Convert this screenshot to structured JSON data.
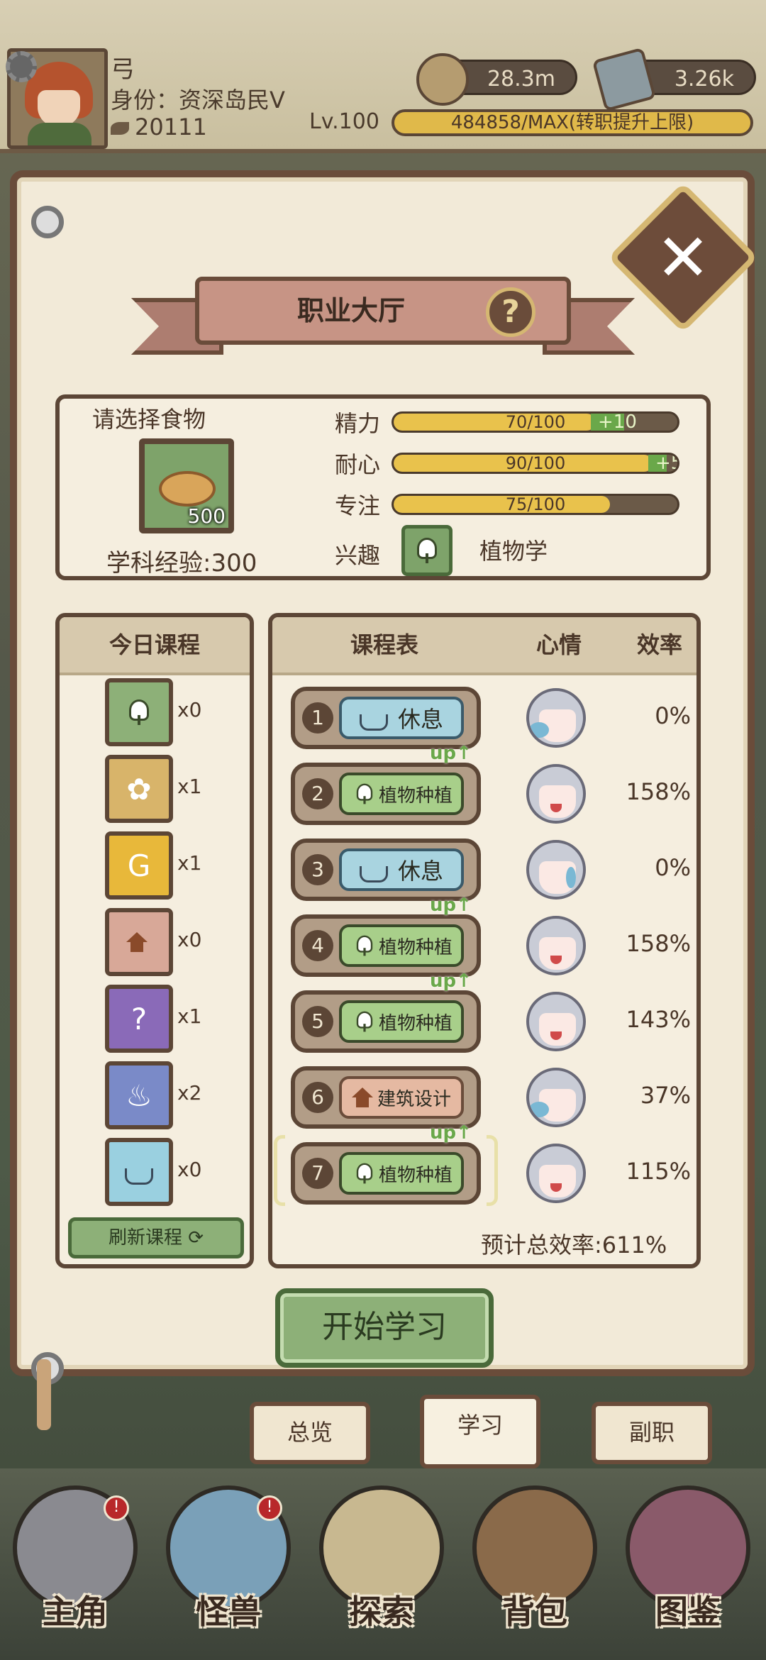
{
  "player": {
    "name": "弓",
    "identity": "身份：资深岛民Ⅴ",
    "leaf_count": "20111",
    "level": "Lv.100",
    "xp_text": "484858/MAX(转职提升上限)"
  },
  "currencies": {
    "coins": "28.3m",
    "stones": "3.26k"
  },
  "panel": {
    "title": "职业大厅",
    "help": "?",
    "close": "✕"
  },
  "food": {
    "label": "请选择食物",
    "count": "500",
    "exp": "学科经验:300"
  },
  "stats": [
    {
      "label": "精力",
      "value": "70/100",
      "bonus": "+10",
      "fill": 0.7,
      "bonus_fill": 0.1
    },
    {
      "label": "耐心",
      "value": "90/100",
      "bonus": "+5",
      "fill": 0.9,
      "bonus_fill": 0.05
    },
    {
      "label": "专注",
      "value": "75/100",
      "bonus": "",
      "fill": 0.75,
      "bonus_fill": 0
    }
  ],
  "interest": {
    "label": "兴趣",
    "value": "植物学"
  },
  "today": {
    "header": "今日课程",
    "items": [
      {
        "icon": "leaf-icon",
        "count": "x0",
        "color": "#8db078"
      },
      {
        "icon": "paw-icon",
        "count": "x1",
        "color": "#d8b46a"
      },
      {
        "icon": "money-bag-icon",
        "count": "x1",
        "color": "#e8b83a"
      },
      {
        "icon": "house-icon",
        "count": "x0",
        "color": "#d8a898"
      },
      {
        "icon": "potion-icon",
        "count": "x1",
        "color": "#8a6ab8"
      },
      {
        "icon": "water-icon",
        "count": "x2",
        "color": "#7a8ac8"
      },
      {
        "icon": "cup-icon",
        "count": "x0",
        "color": "#9ad0e0"
      }
    ],
    "refresh": "刷新课程"
  },
  "schedule": {
    "headers": {
      "course": "课程表",
      "mood": "心情",
      "efficiency": "效率"
    },
    "rows": [
      {
        "num": "1",
        "course": "休息",
        "type": "rest",
        "up": "",
        "mood": "sleepy",
        "eff": "0%"
      },
      {
        "num": "2",
        "course": "植物种植",
        "type": "plant",
        "up": "up↑",
        "mood": "happy",
        "eff": "158%"
      },
      {
        "num": "3",
        "course": "休息",
        "type": "rest",
        "up": "",
        "mood": "crying",
        "eff": "0%"
      },
      {
        "num": "4",
        "course": "植物种植",
        "type": "plant",
        "up": "up↑",
        "mood": "happy",
        "eff": "158%"
      },
      {
        "num": "5",
        "course": "植物种植",
        "type": "plant",
        "up": "up↑",
        "mood": "happy",
        "eff": "143%"
      },
      {
        "num": "6",
        "course": "建筑设计",
        "type": "build",
        "up": "",
        "mood": "sleepy",
        "eff": "37%"
      },
      {
        "num": "7",
        "course": "植物种植",
        "type": "plant",
        "up": "up↑",
        "mood": "happy",
        "eff": "115%"
      }
    ],
    "total": "预计总效率:611%"
  },
  "start_button": "开始学习",
  "tabs": [
    "总览",
    "学习",
    "副职"
  ],
  "active_tab": "学习",
  "nav": [
    {
      "label": "主角",
      "icon": "helmet-icon",
      "badge": "!"
    },
    {
      "label": "怪兽",
      "icon": "monster-icon",
      "badge": "!"
    },
    {
      "label": "探索",
      "icon": "map-icon",
      "badge": ""
    },
    {
      "label": "背包",
      "icon": "backpack-icon",
      "badge": ""
    },
    {
      "label": "图鉴",
      "icon": "book-icon",
      "badge": ""
    }
  ]
}
